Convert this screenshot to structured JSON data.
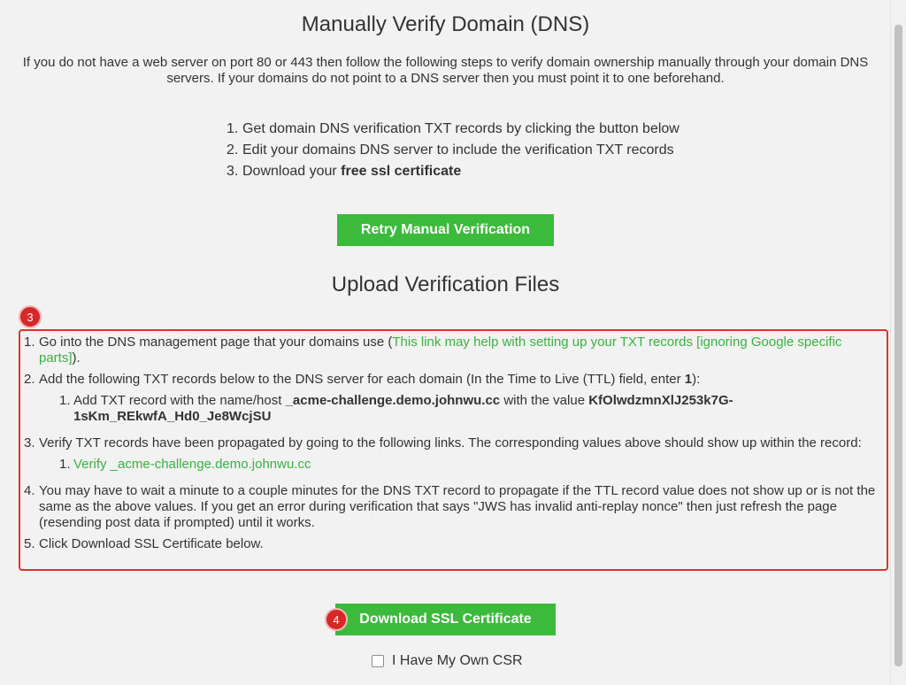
{
  "title": "Manually Verify Domain (DNS)",
  "intro": "If you do not have a web server on port 80 or 443 then follow the following steps to verify domain ownership manually through your domain DNS servers. If your domains do not point to a DNS server then you must point it to one beforehand.",
  "steps": [
    {
      "num": "1.",
      "text": "Get domain DNS verification TXT records by clicking the button below"
    },
    {
      "num": "2.",
      "text": "Edit your domains DNS server to include the verification TXT records"
    },
    {
      "num": "3.",
      "text_before": "Download your ",
      "bold": "free ssl certificate"
    }
  ],
  "retry_button": "Retry Manual Verification",
  "upload_title": "Upload Verification Files",
  "annotations": {
    "badge_3": "3",
    "badge_4": "4",
    "box_color": "#e03030"
  },
  "instructions": {
    "item1": {
      "num": "1.",
      "text_before": "Go into the DNS management page that your domains use (",
      "link": "This link may help with setting up your TXT records [ignoring Google specific parts]",
      "text_after": ")."
    },
    "item2": {
      "num": "2.",
      "text_before": "Add the following TXT records below to the DNS server for each domain (In the Time to Live (TTL) field, enter ",
      "bold": "1",
      "text_after": "):",
      "sub": {
        "num": "1.",
        "text_before": "Add TXT record with the name/host ",
        "host": "_acme-challenge.demo.johnwu.cc",
        "text_middle": " with the value ",
        "value": "KfOlwdzmnXlJ253k7G-1sKm_REkwfA_Hd0_Je8WcjSU"
      }
    },
    "item3": {
      "num": "3.",
      "text": "Verify TXT records have been propagated by going to the following links. The corresponding values above should show up within the record:",
      "sub": {
        "num": "1.",
        "link": "Verify _acme-challenge.demo.johnwu.cc"
      }
    },
    "item4": {
      "num": "4.",
      "text": "You may have to wait a minute to a couple minutes for the DNS TXT record to propagate if the TTL record value does not show up or is not the same as the above values. If you get an error during verification that says \"JWS has invalid anti-replay nonce\" then just refresh the page (resending post data if prompted) until it works."
    },
    "item5": {
      "num": "5.",
      "text": "Click Download SSL Certificate below."
    }
  },
  "download_button": "Download SSL Certificate",
  "csr_label": "I Have My Own CSR",
  "colors": {
    "accent_green": "#3cba3c",
    "link_green": "#3cb043",
    "annotation_red": "#d62828",
    "background": "#f2f2f2"
  }
}
